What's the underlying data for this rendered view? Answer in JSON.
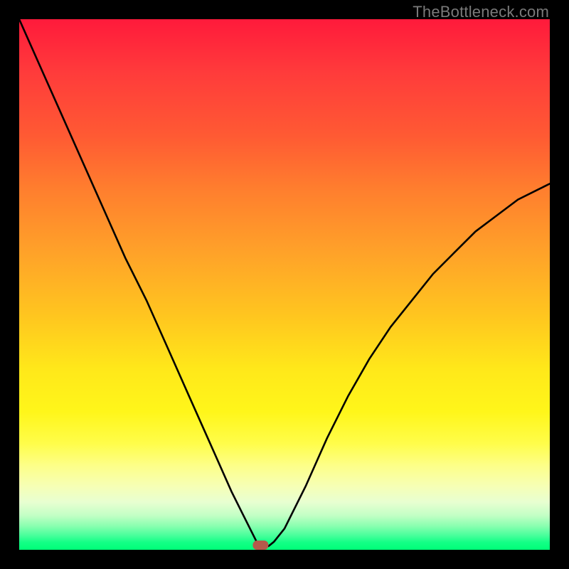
{
  "watermark": "TheBottleneck.com",
  "chart_data": {
    "type": "line",
    "title": "",
    "xlabel": "",
    "ylabel": "",
    "xlim": [
      0,
      100
    ],
    "ylim": [
      0,
      100
    ],
    "series": [
      {
        "name": "bottleneck-curve",
        "x": [
          0,
          4,
          8,
          12,
          16,
          20,
          24,
          28,
          32,
          36,
          40,
          42,
          44,
          45,
          46,
          47,
          48,
          50,
          54,
          58,
          62,
          66,
          70,
          74,
          78,
          82,
          86,
          90,
          94,
          98,
          100
        ],
        "y": [
          100,
          91,
          82,
          73,
          64,
          55,
          47,
          38,
          29,
          20,
          11,
          7,
          3,
          1,
          0.5,
          0.7,
          1.5,
          4,
          12,
          21,
          29,
          36,
          42,
          47,
          52,
          56,
          60,
          63,
          66,
          68,
          69
        ]
      }
    ],
    "marker": {
      "x_pct": 45.5,
      "color": "#b4594b"
    },
    "gradient_stops": [
      {
        "pct": 0,
        "color": "#ff1a3b"
      },
      {
        "pct": 50,
        "color": "#ffc61f"
      },
      {
        "pct": 85,
        "color": "#fcff80"
      },
      {
        "pct": 100,
        "color": "#00ff78"
      }
    ]
  }
}
